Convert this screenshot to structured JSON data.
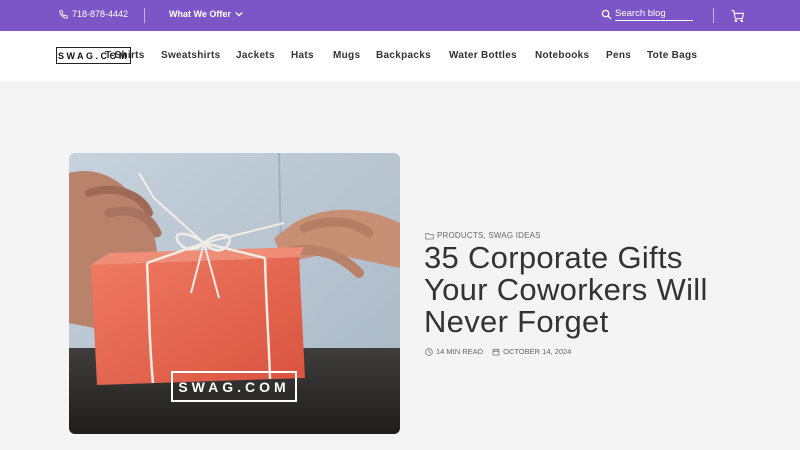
{
  "topbar": {
    "phone": "718-878-4442",
    "offer_label": "What We Offer",
    "search_placeholder": "Search blog"
  },
  "navbar": {
    "logo": "SWAG.COM",
    "items": [
      "T-Shirts",
      "Sweatshirts",
      "Jackets",
      "Hats",
      "Mugs",
      "Backpacks",
      "Water Bottles",
      "Notebooks",
      "Pens",
      "Tote Bags"
    ]
  },
  "article": {
    "categories": "PRODUCTS, SWAG IDEAS",
    "title": "35 Corporate Gifts Your Coworkers Will Never Forget",
    "read_time": "14 MIN READ",
    "date": "OCTOBER 14, 2024",
    "image_logo": "SWAG.COM"
  },
  "colors": {
    "topbar": "#7c56c6",
    "page_bg": "#f4f4f4",
    "gift_box": "#e8654e"
  },
  "icons": {
    "phone": "phone-icon",
    "chevron": "chevron-down-icon",
    "search": "search-icon",
    "cart": "cart-icon",
    "folder": "folder-icon",
    "clock": "clock-icon",
    "calendar": "calendar-icon"
  }
}
